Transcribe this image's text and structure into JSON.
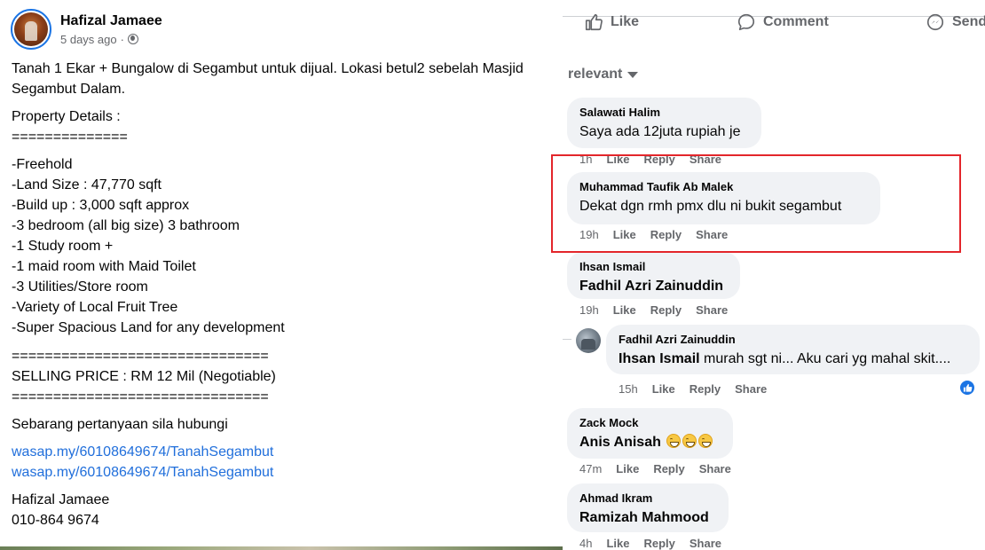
{
  "post": {
    "author": "Hafizal Jamaee",
    "time": "5 days ago",
    "separator": "·",
    "line1": "Tanah 1 Ekar + Bungalow di Segambut untuk dijual. Lokasi betul2 sebelah Masjid",
    "line2": "Segambut Dalam.",
    "details_heading": "Property Details :",
    "rule_short": "==============",
    "details": [
      "-Freehold",
      "-Land Size : 47,770 sqft",
      "-Build up : 3,000 sqft approx",
      "-3 bedroom (all big size) 3 bathroom",
      "-1 Study room +",
      "-1 maid room with Maid Toilet",
      "-3 Utilities/Store room",
      "-Variety of Local Fruit Tree",
      "-Super Spacious Land for any development"
    ],
    "rule_long": "===============================",
    "price": "SELLING PRICE : RM 12 Mil (Negotiable)",
    "contact_prompt": "Sebarang pertanyaan sila hubungi",
    "links": [
      "wasap.my/60108649674/TanahSegambut",
      "wasap.my/60108649674/TanahSegambut"
    ],
    "contact_name": "Hafizal Jamaee",
    "contact_phone": "010-864 9674"
  },
  "actions": {
    "like": "Like",
    "comment": "Comment",
    "send": "Send"
  },
  "sort_label": "relevant",
  "comments": [
    {
      "name": "Salawati Halim",
      "text": "Saya ada 12juta rupiah je",
      "time": "1h",
      "like": "Like",
      "reply": "Reply",
      "share": "Share"
    },
    {
      "name": "Muhammad Taufik Ab Malek",
      "text": "Dekat dgn rmh pmx dlu ni bukit segambut",
      "time": "19h",
      "like": "Like",
      "reply": "Reply",
      "share": "Share"
    },
    {
      "name": "Ihsan Ismail",
      "text": "Fadhil Azri Zainuddin",
      "time": "19h",
      "like": "Like",
      "reply": "Reply",
      "share": "Share"
    },
    {
      "name": "Fadhil Azri Zainuddin",
      "mention": "Ihsan Ismail",
      "text": " murah sgt ni... Aku cari yg mahal skit....",
      "time": "15h",
      "like": "Like",
      "reply": "Reply",
      "share": "Share"
    },
    {
      "name": "Zack Mock",
      "text": "Anis Anisah",
      "time": "47m",
      "like": "Like",
      "reply": "Reply",
      "share": "Share"
    },
    {
      "name": "Ahmad Ikram",
      "text": "Ramizah Mahmood",
      "time": "4h",
      "like": "Like",
      "reply": "Reply",
      "share": "Share"
    }
  ],
  "colors": {
    "accent": "#1b74e4",
    "highlight": "#e3262b",
    "bubble": "#f0f2f5",
    "link": "#216fdb"
  }
}
